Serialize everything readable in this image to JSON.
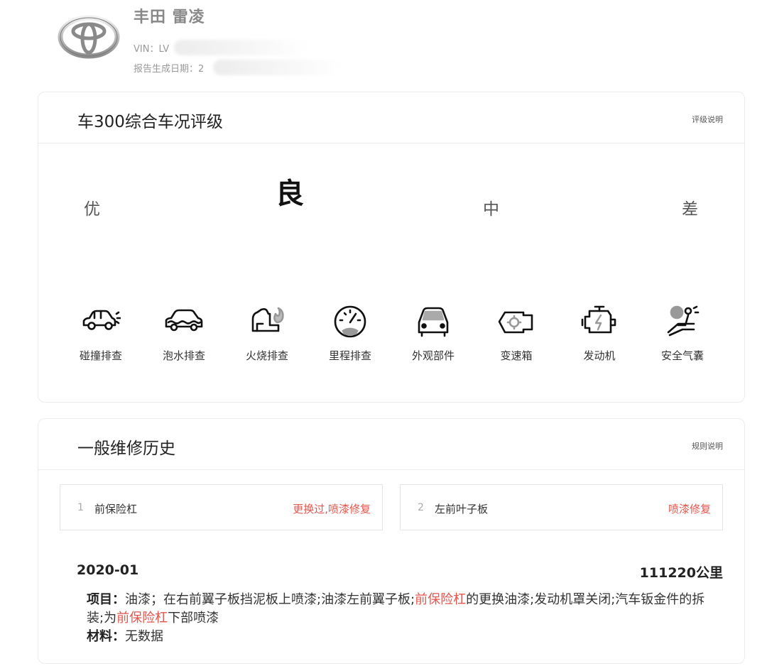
{
  "vehicle": {
    "name": "丰田 雷凌",
    "vin_label": "VIN：LV",
    "date_label": "报告生成日期：2"
  },
  "rating": {
    "title": "车300综合车况评级",
    "explain_link": "评级说明",
    "grades": [
      "优",
      "良",
      "中",
      "差"
    ],
    "current": "良",
    "checks": [
      {
        "label": "碰撞排查",
        "icon": "collision-car-icon"
      },
      {
        "label": "泡水排查",
        "icon": "flood-car-icon"
      },
      {
        "label": "火烧排查",
        "icon": "fire-car-icon"
      },
      {
        "label": "里程排查",
        "icon": "odometer-icon"
      },
      {
        "label": "外观部件",
        "icon": "car-front-icon"
      },
      {
        "label": "变速箱",
        "icon": "gearbox-icon"
      },
      {
        "label": "发动机",
        "icon": "engine-icon"
      },
      {
        "label": "安全气囊",
        "icon": "airbag-icon"
      }
    ]
  },
  "maintenance": {
    "title": "一般维修历史",
    "rules_link": "规则说明",
    "parts": [
      {
        "index": "1",
        "name": "前保险杠",
        "status": "更换过,喷漆修复"
      },
      {
        "index": "2",
        "name": "左前叶子板",
        "status": "喷漆修复"
      }
    ],
    "record": {
      "date": "2020-01",
      "mileage": "111220公里",
      "project_label": "项目：",
      "project_seg1": "油漆；在右前翼子板挡泥板上喷漆;油漆左前翼子板;",
      "project_hl1": "前保险杠",
      "project_seg2": "的更换油漆;发动机罩关闭;汽车钣金件的拆装;为",
      "project_hl2": "前保险杠",
      "project_seg3": "下部喷漆",
      "material_label": "材料：",
      "material_value": "无数据"
    }
  },
  "colors": {
    "accent_red": "#e4554d",
    "border": "#ececec"
  }
}
